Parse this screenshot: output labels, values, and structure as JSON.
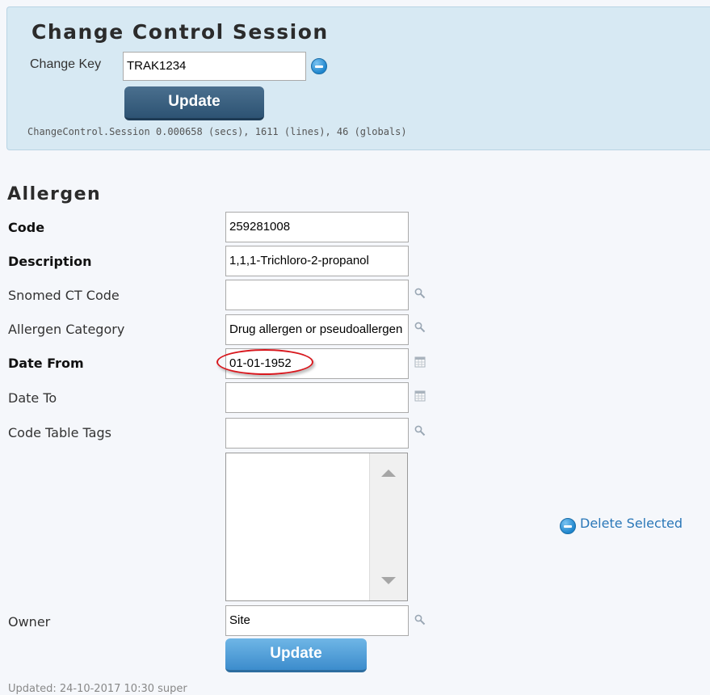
{
  "session": {
    "title": "Change Control Session",
    "change_key_label": "Change Key",
    "change_key_value": "TRAK1234",
    "update_label": "Update",
    "stats": "ChangeControl.Session  0.000658 (secs),  1611 (lines),  46 (globals)"
  },
  "form": {
    "title": "Allergen",
    "fields": [
      {
        "label": "Code",
        "value": "259281008"
      },
      {
        "label": "Description",
        "value": "1,1,1-Trichloro-2-propanol"
      },
      {
        "label": "Snomed CT Code",
        "value": "",
        "icon": "search-icon"
      },
      {
        "label": "Allergen Category",
        "value": "Drug allergen or pseudoallergen",
        "icon": "search-icon"
      },
      {
        "label": "Date From",
        "value": "01-01-1952",
        "icon": "calendar-icon"
      },
      {
        "label": "Date To",
        "value": "",
        "icon": "calendar-icon"
      },
      {
        "label": "Code Table Tags",
        "value": "",
        "icon": "search-icon"
      },
      {
        "label": "Owner",
        "value": "Site",
        "icon": "search-icon"
      }
    ],
    "delete_selected_label": "Delete Selected",
    "update_label": "Update",
    "updated_text": "Updated:  24-10-2017 10:30 super"
  },
  "colors": {
    "session_bg": "#d7e9f3",
    "update_dark": "#2d5373",
    "update_light": "#4a9ad6",
    "link": "#2a77b8",
    "highlight": "#d8181e"
  }
}
